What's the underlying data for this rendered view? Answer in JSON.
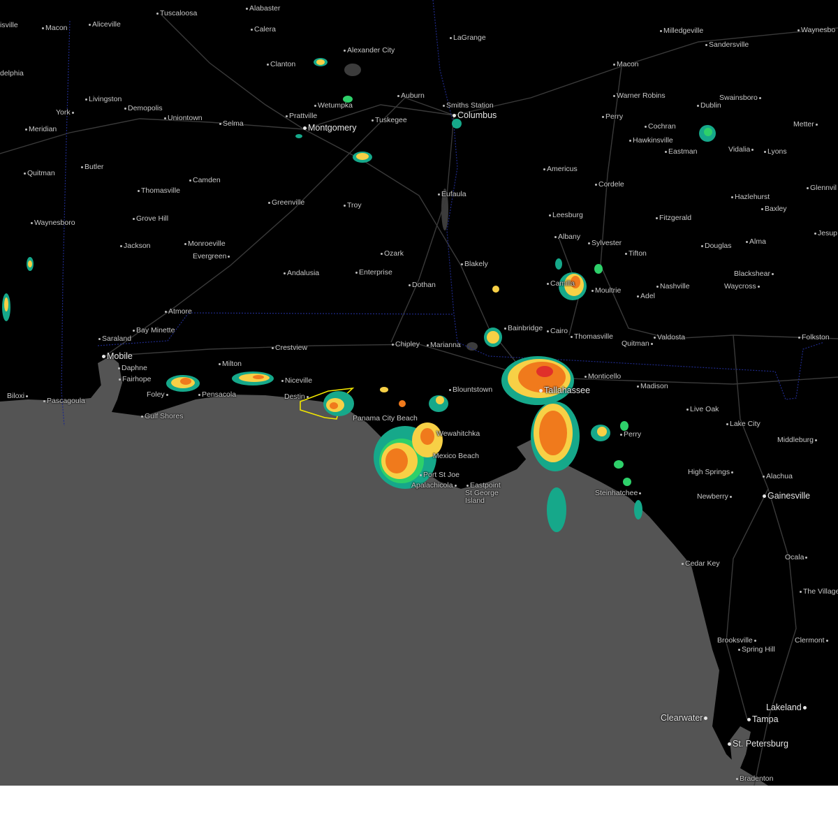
{
  "colors": {
    "land": "#000000",
    "water": "#545454",
    "roads": "#3a3a3a",
    "state_border": "#1f2a8a",
    "warning_polygon": "#f2e600",
    "radar_light": "#16a88a",
    "radar_moderate": "#2ed06a",
    "radar_heavy": "#f7d046",
    "radar_intense": "#f07a1c",
    "radar_extreme": "#e0302a"
  },
  "cities": {
    "c1": "isville",
    "c2": "Macon",
    "c3": "Aliceville",
    "c4": "Tuscaloosa",
    "c5": "Alabaster",
    "c6": "Calera",
    "c7": "LaGrange",
    "c8": "Milledgeville",
    "c9": "Waynesbo",
    "c10": "Sandersville",
    "c11": "Alexander City",
    "c12": "Clanton",
    "c13": "Macon",
    "c14": "delphia",
    "c15": "Livingston",
    "c16": "Auburn",
    "c17": "Smiths Station",
    "c18": "Warner Robins",
    "c19": "Swainsboro",
    "c20": "York",
    "c21": "Demopolis",
    "c22": "Wetumpka",
    "c23": "Columbus",
    "c24": "Perry",
    "c25": "Dublin",
    "c26": "Uniontown",
    "c27": "Prattville",
    "c28": "Tuskegee",
    "c29": "Meridian",
    "c30": "Selma",
    "c31": "Montgomery",
    "c32": "Cochran",
    "c33": "Metter",
    "c34": "Hawkinsville",
    "c35": "Eastman",
    "c36": "Vidalia",
    "c37": "Lyons",
    "c38": "Butler",
    "c39": "Americus",
    "c40": "Quitman",
    "c41": "Camden",
    "c42": "Thomasville",
    "c43": "Eufaula",
    "c44": "Cordele",
    "c45": "Glennvil",
    "c46": "Greenville",
    "c47": "Troy",
    "c48": "Hazlehurst",
    "c49": "Baxley",
    "c50": "Grove Hill",
    "c51": "Leesburg",
    "c52": "Fitzgerald",
    "c53": "Waynesboro",
    "c54": "Jesup",
    "c55": "Albany",
    "c56": "Monroeville",
    "c57": "Jackson",
    "c58": "Sylvester",
    "c59": "Douglas",
    "c60": "Alma",
    "c61": "Evergreen",
    "c62": "Ozark",
    "c63": "Tifton",
    "c64": "Blakely",
    "c65": "Andalusia",
    "c66": "Enterprise",
    "c67": "Blackshear",
    "c68": "Camilla",
    "c69": "Dothan",
    "c70": "Nashville",
    "c71": "Waycross",
    "c72": "Moultrie",
    "c73": "Adel",
    "c74": "Atmore",
    "c75": "Bay Minette",
    "c76": "Bainbridge",
    "c77": "Cairo",
    "c78": "Thomasville",
    "c79": "Valdosta",
    "c80": "Folkston",
    "c81": "Saraland",
    "c82": "Quitman",
    "c83": "Crestview",
    "c84": "Chipley",
    "c85": "Marianna",
    "c86": "Mobile",
    "c87": "Daphne",
    "c88": "Milton",
    "c89": "Fairhope",
    "c90": "Monticello",
    "c91": "Niceville",
    "c92": "Madison",
    "c93": "Blountstown",
    "c94": "Tallahassee",
    "c95": "Biloxi",
    "c96": "Pascagoula",
    "c97": "Foley",
    "c98": "Pensacola",
    "c99": "Destin",
    "c100": "Live Oak",
    "c101": "Gulf Shores",
    "c102": "Panama City Beach",
    "c103": "Lake City",
    "c104": "Middleburg",
    "c105": "Wewahitchka",
    "c106": "Perry",
    "c107": "Mexico Beach",
    "c108": "High Springs",
    "c109": "Alachua",
    "c110": "Port St Joe",
    "c111": "Newberry",
    "c112": "Gainesville",
    "c113": "Apalachicola",
    "c114": "Eastpoint",
    "c115": "St George Island",
    "c116": "Steinhatchee",
    "c117": "Ocala",
    "c118": "Cedar Key",
    "c119": "The Villages",
    "c120": "Brooksville",
    "c121": "Clermont",
    "c122": "Spring Hill",
    "c123": "Lakeland",
    "c124": "Clearwater",
    "c125": "Tampa",
    "c126": "St. Petersburg",
    "c127": "Bradenton"
  }
}
